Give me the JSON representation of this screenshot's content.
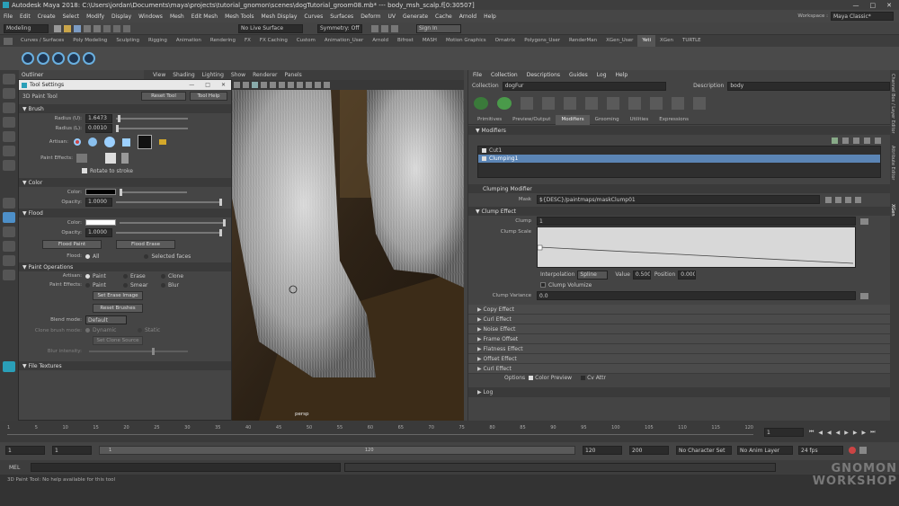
{
  "title_bar": {
    "text": "Autodesk Maya 2018: C:\\Users\\jordan\\Documents\\maya\\projects\\tutorial_gnomon\\scenes\\dogTutorial_groom08.mb*  ---  body_msh_scalp.f[0:30507]"
  },
  "main_menu": [
    "File",
    "Edit",
    "Create",
    "Select",
    "Modify",
    "Display",
    "Windows",
    "Mesh",
    "Edit Mesh",
    "Mesh Tools",
    "Mesh Display",
    "Curves",
    "Surfaces",
    "Deform",
    "UV",
    "Generate",
    "Cache",
    "Arnold",
    "Help"
  ],
  "workspace": {
    "label": "Workspace :",
    "value": "Maya Classic*"
  },
  "status_line": {
    "menu_set": "Modeling",
    "live_surface": "No Live Surface",
    "symmetry": "Symmetry: Off",
    "sign_in": "Sign In"
  },
  "shelf_tabs": [
    "Curves / Surfaces",
    "Poly Modeling",
    "Sculpting",
    "Rigging",
    "Animation",
    "Rendering",
    "FX",
    "FX Caching",
    "Custom",
    "Animation_User",
    "Arnold",
    "Bifrost",
    "MASH",
    "Motion Graphics",
    "Ornatrix",
    "Polygons_User",
    "RenderMan",
    "XGen_User",
    "Yeti",
    "XGen",
    "TURTLE"
  ],
  "shelf_active_tab": "Yeti",
  "panel_menu": [
    "View",
    "Shading",
    "Lighting",
    "Show",
    "Renderer",
    "Panels"
  ],
  "outliner_label": "Outliner",
  "tool_settings": {
    "window_title": "Tool Settings",
    "tool_name": "3D Paint Tool",
    "reset_tool": "Reset Tool",
    "tool_help": "Tool Help",
    "brush": {
      "header": "Brush",
      "radius_u_label": "Radius (U):",
      "radius_u": "1.6473",
      "radius_l_label": "Radius (L):",
      "radius_l": "0.0010",
      "artisan_label": "Artisan:",
      "paint_effects_label": "Paint Effects:",
      "rotate_to_stroke": "Rotate to stroke"
    },
    "color": {
      "header": "Color",
      "color_label": "Color:",
      "opacity_label": "Opacity:",
      "opacity": "1.0000"
    },
    "flood": {
      "header": "Flood",
      "color_label": "Color:",
      "opacity_label": "Opacity:",
      "opacity": "1.0000",
      "flood_paint": "Flood Paint",
      "flood_erase": "Flood Erase",
      "flood_label": "Flood:",
      "all": "All",
      "selected_faces": "Selected faces"
    },
    "paint_operations": {
      "header": "Paint Operations",
      "artisan_label": "Artisan:",
      "paint": "Paint",
      "erase": "Erase",
      "clone": "Clone",
      "paint_effects_label": "Paint Effects:",
      "paint2": "Paint",
      "smear": "Smear",
      "blur": "Blur",
      "set_erase_image": "Set Erase Image",
      "reset_brushes": "Reset Brushes",
      "blend_mode_label": "Blend mode:",
      "blend_mode": "Default",
      "clone_brush_mode_label": "Clone brush mode:",
      "dynamic": "Dynamic",
      "static": "Static",
      "set_clone_source": "Set Clone Source",
      "blur_intensity_label": "Blur intensity:"
    },
    "file_textures": {
      "header": "File Textures"
    }
  },
  "viewport": {
    "camera_label": "persp"
  },
  "xgen": {
    "menu": [
      "File",
      "Collection",
      "Descriptions",
      "Guides",
      "Log",
      "Help"
    ],
    "collection_label": "Collection",
    "collection": "dogFur",
    "description_label": "Description",
    "description": "body",
    "tabs": [
      "Primitives",
      "Preview/Output",
      "Modifiers",
      "Grooming",
      "Utilities",
      "Expressions"
    ],
    "active_tab": "Modifiers",
    "modifiers_header": "Modifiers",
    "modifier_list": [
      "Cut1",
      "Clumping1"
    ],
    "selected_modifier": "Clumping1",
    "clumping_header": "Clumping Modifier",
    "mask_label": "Mask",
    "mask": "${DESC}/paintmaps/maskClump01",
    "clump_effect_header": "Clump Effect",
    "clump_label": "Clump",
    "clump": "1",
    "clump_scale_label": "Clump Scale",
    "interpolation_label": "Interpolation",
    "interpolation": "Spline",
    "value_label": "Value",
    "value": "0.500",
    "position_label": "Position",
    "position": "0.000",
    "clump_volumize": "Clump Volumize",
    "clump_variance_label": "Clump Variance",
    "clump_variance": "0.0",
    "sections": [
      "Copy Effect",
      "Curl Effect",
      "Noise Effect",
      "Frame Offset",
      "Flatness Effect",
      "Offset Effect",
      "Curl Effect"
    ],
    "options_label": "Options",
    "color_preview": "Color Preview",
    "cv_attr": "Cv Attr",
    "log_label": "Log"
  },
  "right_dock_tabs": [
    "Channel Box / Layer Editor",
    "Attribute Editor",
    "XGen"
  ],
  "time_slider": {
    "ticks": [
      "1",
      "5",
      "10",
      "15",
      "20",
      "25",
      "30",
      "35",
      "40",
      "45",
      "50",
      "55",
      "60",
      "65",
      "70",
      "75",
      "80",
      "85",
      "90",
      "95",
      "100",
      "105",
      "110",
      "115",
      "120"
    ],
    "current_frame": "1"
  },
  "range": {
    "start": "1",
    "inner_start": "1",
    "inner_end": "120",
    "end": "120",
    "total_end": "200",
    "char_set": "No Character Set",
    "anim_layer": "No Anim Layer",
    "fps": "24 fps",
    "bar_value": "1"
  },
  "mel": {
    "label": "MEL"
  },
  "help_line": "3D Paint Tool: No help available for this tool",
  "watermark": {
    "line1": "GNOMON",
    "line2": "WORKSHOP"
  }
}
